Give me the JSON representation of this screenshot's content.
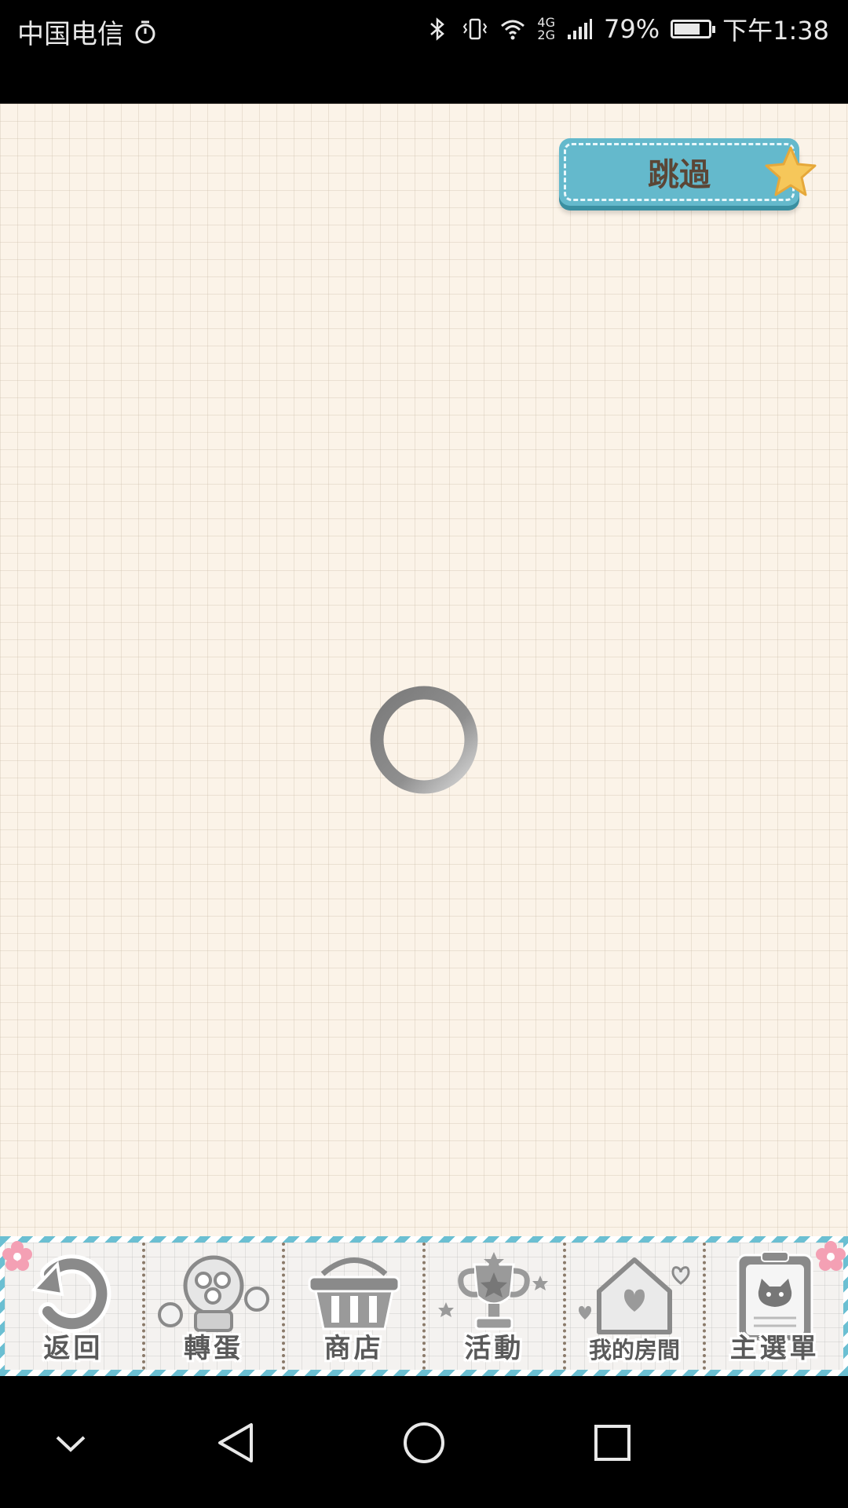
{
  "status_bar": {
    "carrier": "中国电信",
    "network_type_top": "4G",
    "network_type_bottom": "2G",
    "battery_percent": "79%",
    "battery_level": 0.79,
    "time": "下午1:38",
    "icons": [
      "alarm-icon",
      "bluetooth-icon",
      "vibrate-icon",
      "wifi-icon",
      "signal-icon",
      "battery-icon"
    ]
  },
  "game": {
    "skip_label": "跳過",
    "loading": true
  },
  "bottom_nav": {
    "items": [
      {
        "label": "返回",
        "icon": "return-arrow-icon"
      },
      {
        "label": "轉蛋",
        "icon": "gacha-machine-icon"
      },
      {
        "label": "商店",
        "icon": "shop-basket-icon"
      },
      {
        "label": "活動",
        "icon": "trophy-icon"
      },
      {
        "label": "我的房間",
        "icon": "house-icon"
      },
      {
        "label": "主選單",
        "icon": "clipboard-cat-icon"
      }
    ]
  },
  "system_nav": {
    "icons": [
      "collapse-icon",
      "back-icon",
      "home-icon",
      "recents-icon"
    ]
  },
  "colors": {
    "accent_blue": "#64b9cc",
    "paper_bg": "#fbf3e8",
    "star_yellow": "#f6c75a",
    "flower_pink": "#f4a0b4"
  }
}
